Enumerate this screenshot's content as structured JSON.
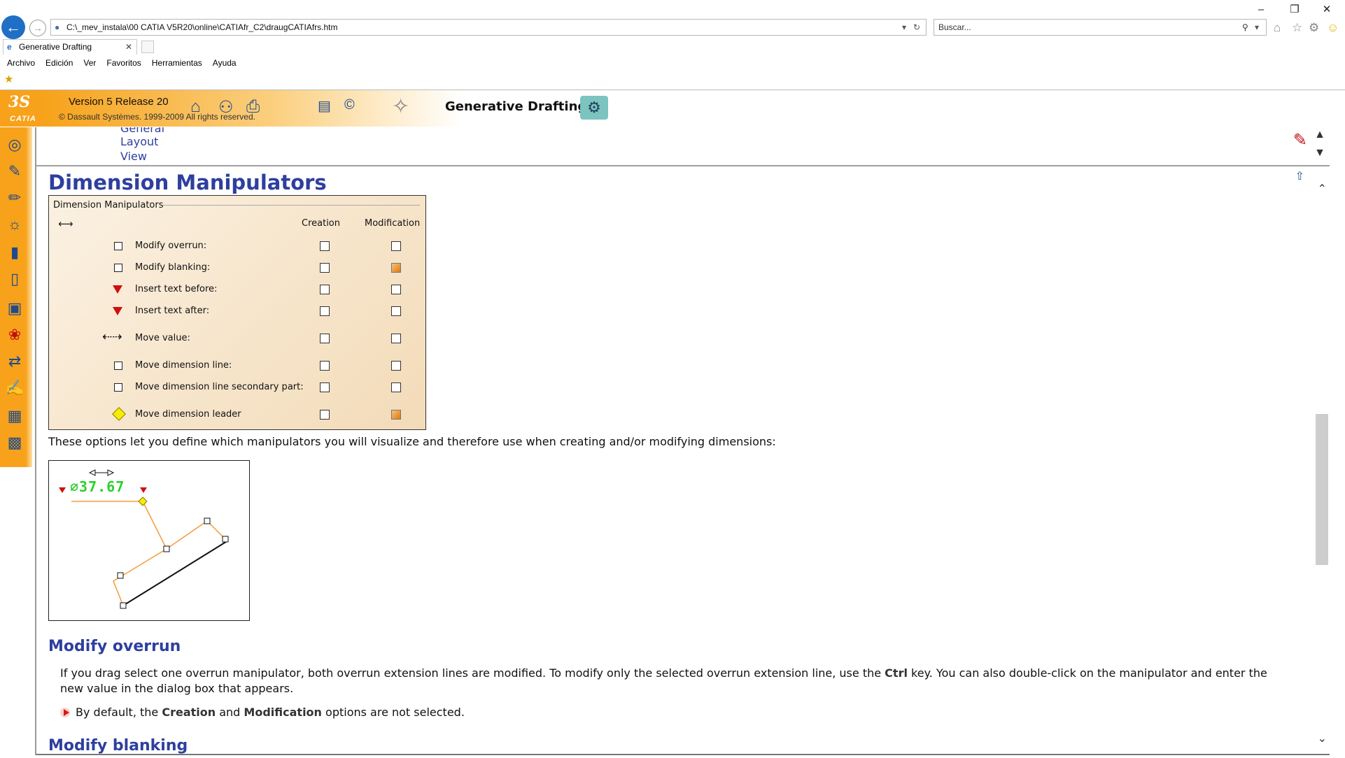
{
  "browser": {
    "address": "C:\\_mev_instala\\00 CATIA V5R20\\online\\CATIAfr_C2\\draugCATIAfrs.htm",
    "search_placeholder": "Buscar...",
    "tab_title": "Generative Drafting",
    "menu": [
      "Archivo",
      "Edición",
      "Ver",
      "Favoritos",
      "Herramientas",
      "Ayuda"
    ]
  },
  "header": {
    "logo_text": "CATIA",
    "version": "Version 5 Release 20",
    "copyright": "© Dassault Systèmes. 1999-2009 All rights reserved.",
    "product": "Generative Drafting"
  },
  "toc": {
    "links": [
      "General",
      "Layout",
      "View"
    ]
  },
  "content": {
    "title": "Dimension Manipulators",
    "panel": {
      "legend": "Dimension Manipulators",
      "col_creation": "Creation",
      "col_modification": "Modification",
      "options": [
        {
          "label": "Modify overrun:",
          "marker": "square",
          "creation": false,
          "modification": false
        },
        {
          "label": "Modify blanking:",
          "marker": "square",
          "creation": false,
          "modification": true
        },
        {
          "label": "Insert text before:",
          "marker": "triangle",
          "creation": false,
          "modification": false
        },
        {
          "label": "Insert text after:",
          "marker": "triangle",
          "creation": false,
          "modification": false
        },
        {
          "label": "Move value:",
          "marker": "arrows",
          "creation": false,
          "modification": false
        },
        {
          "label": "Move dimension line:",
          "marker": "square",
          "creation": false,
          "modification": false
        },
        {
          "label": "Move dimension line secondary part:",
          "marker": "square",
          "creation": false,
          "modification": false
        },
        {
          "label": "Move dimension leader",
          "marker": "diamond",
          "creation": false,
          "modification": true
        }
      ]
    },
    "description": "These options let you define which manipulators you will visualize and therefore use when creating and/or modifying dimensions:",
    "figure_value": "∅37.67",
    "section1": {
      "heading": "Modify overrun",
      "para_1": "If you drag select one overrun manipulator, both overrun extension lines are modified. To modify only the selected overrun extension line, use the ",
      "para_key": "Ctrl",
      "para_2": " key. You can also double-click on the manipulator and enter the new value in the dialog box that appears.",
      "note_1": "By default, the ",
      "note_creation": "Creation",
      "note_and": " and ",
      "note_modification": "Modification",
      "note_2": " options are not selected."
    },
    "section2": {
      "heading": "Modify blanking"
    }
  },
  "icons": {
    "back": "back-arrow-icon",
    "forward": "forward-arrow-icon",
    "home": "home-icon",
    "favorites": "star-icon",
    "settings": "gear-icon",
    "smiley": "feedback-smiley-icon"
  },
  "colors": {
    "catia_orange": "#f7a21a",
    "link_blue": "#2e3f9e",
    "value_green": "#2ad12a",
    "manipulator_red": "#d01010",
    "leader_yellow": "#f6ee00",
    "leader_line": "#f59a3c"
  }
}
